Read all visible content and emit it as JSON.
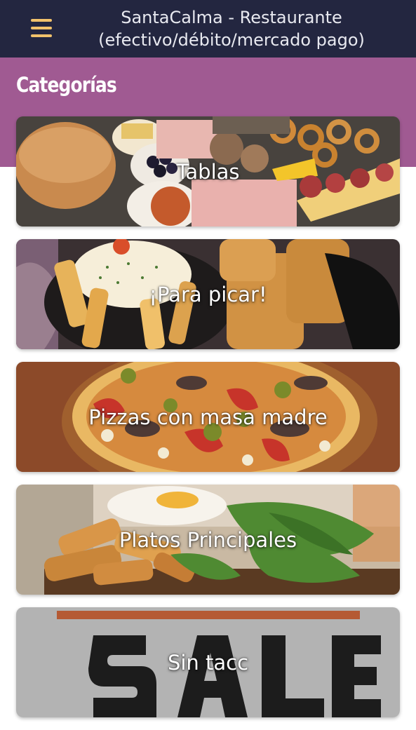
{
  "header": {
    "title": "SantaCalma - Restaurante (efectivo/débito/mercado pago)",
    "menu_icon": "hamburger-menu-icon",
    "background": "#232640",
    "icon_color": "#f2c26b"
  },
  "section": {
    "heading": "Categorías",
    "band_color": "#a05a92"
  },
  "categories": [
    {
      "label": "Tablas"
    },
    {
      "label": "¡Para picar!"
    },
    {
      "label": "Pizzas con masa madre"
    },
    {
      "label": "Platos Principales"
    },
    {
      "label": "Sin tacc"
    }
  ]
}
